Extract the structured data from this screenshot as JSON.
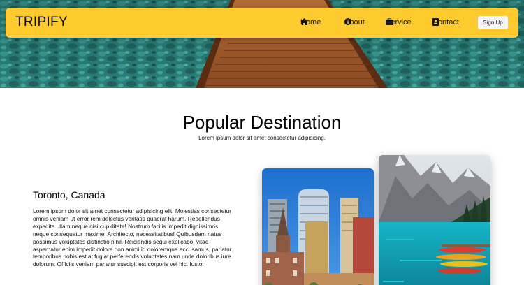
{
  "brand": "TRIPIFY",
  "nav": {
    "home": "Home",
    "about": "About",
    "service": "Service",
    "contact": "Contact",
    "signup": "Sign Up"
  },
  "icons": {
    "home": "home-icon",
    "about": "info-icon",
    "service": "briefcase-icon",
    "contact": "contact-card-icon"
  },
  "section": {
    "title": "Popular Destination",
    "subtitle": "Lorem ipsum dolor sit amet consectetur adipisicing."
  },
  "destination": {
    "title": "Toronto, Canada",
    "text": "Lorem ipsum dolor sit amet consectetur adipisicing elit. Molestias consectetur omnis veniam ut error rem delectus veritatis quaerat harum. Repellendus expedita ullam neque nisi cupiditate! Nostrum facilis impedit dignissimos neque consequatur maxime. Architecto, necessitatibus! Quibusdam natus possimus voluptates distinctio nihil. Reiciendis sequi explicabo, vitae aspernatur enim impedit dolore non animi id doloremque accusamus, pariatur temporibus nobis est at fugiat perferendis voluptates nam unde doloribus iure dolorum. Officiis veniam pariatur suscipit est corporis vel hic. Iusto."
  },
  "colors": {
    "navbar": "#fdcb2e",
    "signup_bg": "#f5f5f5",
    "water": "#2e8a86",
    "boardwalk": "#8b4a22"
  }
}
